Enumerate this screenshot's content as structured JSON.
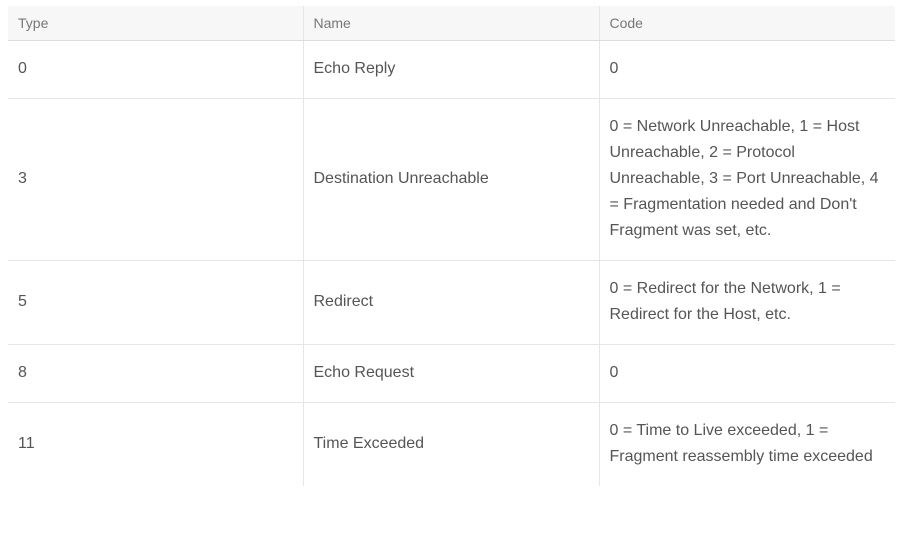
{
  "table": {
    "headers": [
      "Type",
      "Name",
      "Code"
    ],
    "rows": [
      {
        "type": "0",
        "name": "Echo Reply",
        "code": "0"
      },
      {
        "type": "3",
        "name": "Destination Unreachable",
        "code": "0 = Network Unreachable, 1 = Host Unreachable, 2 = Protocol Unreachable, 3 = Port Unreachable, 4 = Fragmentation needed and Don't Fragment was set, etc."
      },
      {
        "type": "5",
        "name": "Redirect",
        "code": "0 = Redirect for the Network, 1 = Redirect for the Host, etc."
      },
      {
        "type": "8",
        "name": "Echo Request",
        "code": "0"
      },
      {
        "type": "11",
        "name": "Time Exceeded",
        "code": "0 = Time to Live exceeded, 1 = Fragment reassembly time exceeded"
      }
    ]
  }
}
